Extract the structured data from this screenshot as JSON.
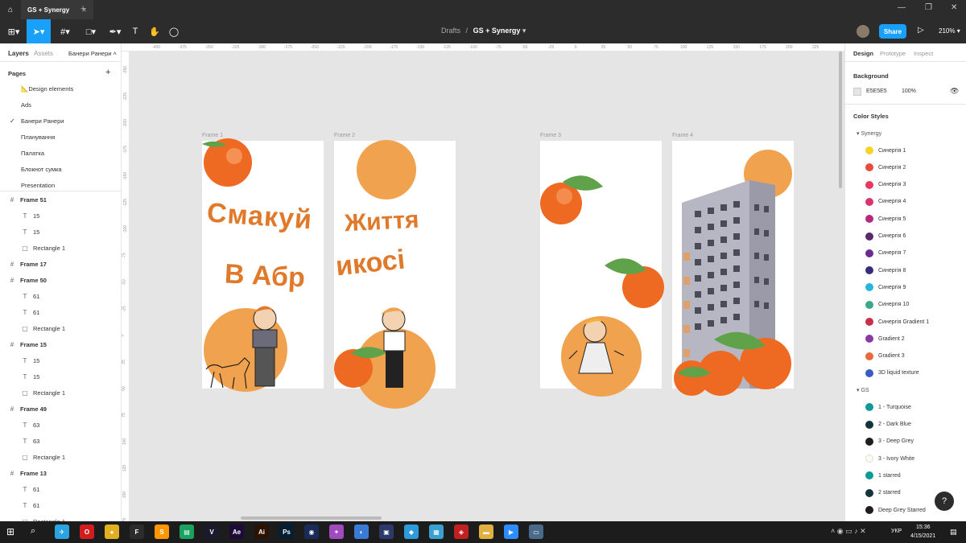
{
  "window": {
    "tab_title": "GS + Synergy",
    "new_tab": "+"
  },
  "toolbar": {
    "breadcrumb_parent": "Drafts",
    "breadcrumb_sep": "/",
    "file_name": "GS + Synergy",
    "share_label": "Share",
    "zoom": "210%",
    "accent": "#18a0fb"
  },
  "left": {
    "tabs": [
      "Layers",
      "Assets"
    ],
    "current_page": "Банери Ранери",
    "pages_label": "Pages",
    "add_icon": "+",
    "pages": [
      {
        "label": "📐Design elements",
        "checked": false
      },
      {
        "label": "Ads",
        "checked": false
      },
      {
        "label": "Банери Ранери",
        "checked": true
      },
      {
        "label": "Планування",
        "checked": false
      },
      {
        "label": "Палатка",
        "checked": false
      },
      {
        "label": "Блокнот сумка",
        "checked": false
      },
      {
        "label": "Presentation",
        "checked": false
      }
    ],
    "layers": [
      {
        "label": "Frame 51",
        "type": "frame"
      },
      {
        "label": "15",
        "type": "text"
      },
      {
        "label": "15",
        "type": "text"
      },
      {
        "label": "Rectangle 1",
        "type": "rect"
      },
      {
        "label": "Frame 17",
        "type": "frame"
      },
      {
        "label": "Frame 50",
        "type": "frame"
      },
      {
        "label": "61",
        "type": "text"
      },
      {
        "label": "61",
        "type": "text"
      },
      {
        "label": "Rectangle 1",
        "type": "rect"
      },
      {
        "label": "Frame 15",
        "type": "frame"
      },
      {
        "label": "15",
        "type": "text"
      },
      {
        "label": "15",
        "type": "text"
      },
      {
        "label": "Rectangle 1",
        "type": "rect"
      },
      {
        "label": "Frame 49",
        "type": "frame"
      },
      {
        "label": "63",
        "type": "text"
      },
      {
        "label": "63",
        "type": "text"
      },
      {
        "label": "Rectangle 1",
        "type": "rect"
      },
      {
        "label": "Frame 13",
        "type": "frame"
      },
      {
        "label": "61",
        "type": "text"
      },
      {
        "label": "61",
        "type": "text"
      },
      {
        "label": "Rectangle 1",
        "type": "rect"
      }
    ]
  },
  "right": {
    "tabs": [
      "Design",
      "Prototype",
      "Inspect"
    ],
    "background_label": "Background",
    "bg_hex": "E5E5E5",
    "bg_opacity": "100%",
    "color_styles_label": "Color Styles",
    "groups": [
      {
        "name": "Synergy",
        "items": [
          {
            "label": "Синергія 1",
            "color": "#f5d328"
          },
          {
            "label": "Синергія 2",
            "color": "#e84c3d"
          },
          {
            "label": "Синергія 3",
            "color": "#e63a5c"
          },
          {
            "label": "Синергія 4",
            "color": "#d83570"
          },
          {
            "label": "Синергія 5",
            "color": "#b52a7c"
          },
          {
            "label": "Синергія 6",
            "color": "#5b2a6e"
          },
          {
            "label": "Синергія 7",
            "color": "#6a2c8e"
          },
          {
            "label": "Синергія 8",
            "color": "#3b2b7e"
          },
          {
            "label": "Синергія 9",
            "color": "#26b5e0"
          },
          {
            "label": "Синергія 10",
            "color": "#3aa88a"
          },
          {
            "label": "Синергія Gradient 1",
            "color": "#c8304a"
          },
          {
            "label": "Gradient 2",
            "color": "#8a3aa0"
          },
          {
            "label": "Gradient 3",
            "color": "#e86a3a"
          },
          {
            "label": "3D liquid texture",
            "color": "#3a5ac8"
          }
        ]
      },
      {
        "name": "GS",
        "items": [
          {
            "label": "1 - Turquoise",
            "color": "#0f9a9a"
          },
          {
            "label": "2 - Dark Blue",
            "color": "#12343b"
          },
          {
            "label": "3 - Deep Grey",
            "color": "#1e1e1e"
          },
          {
            "label": "3 - Ivory White",
            "color": "#fbfbee"
          },
          {
            "label": "1 starred",
            "color": "#0f9a9a"
          },
          {
            "label": "2 starred",
            "color": "#12343b"
          },
          {
            "label": "Deep Grey Starred",
            "color": "#1e1e1e"
          }
        ]
      }
    ],
    "help": "?"
  },
  "canvas": {
    "ruler_top": [
      "-400",
      "-375",
      "-350",
      "-325",
      "-300",
      "-275",
      "-250",
      "-225",
      "-200",
      "-175",
      "-150",
      "-125",
      "-100",
      "-75",
      "-50",
      "-25",
      "0",
      "25",
      "50",
      "75",
      "100",
      "125",
      "150",
      "175",
      "200",
      "225"
    ],
    "ruler_left": [
      "-250",
      "-225",
      "-200",
      "-175",
      "-150",
      "-125",
      "-100",
      "-75",
      "-50",
      "-25",
      "0",
      "25",
      "50",
      "75",
      "100",
      "125",
      "150",
      "175",
      "200"
    ],
    "frames": [
      {
        "label": "Frame 1",
        "text1": "Смакуй",
        "text2": "В Абр"
      },
      {
        "label": "Frame 2",
        "text1": "Життя",
        "text2": "икосі"
      },
      {
        "label": "Frame 3"
      },
      {
        "label": "Frame 4"
      }
    ],
    "text_color": "#e07a2a",
    "orange": "#f0a24f"
  },
  "taskbar": {
    "lang": "УКР",
    "time": "15:36",
    "date": "4/15/2021",
    "apps": [
      {
        "icon": "telegram-icon",
        "color": "#2aa3e0",
        "glyph": "✈"
      },
      {
        "icon": "opera-icon",
        "color": "#d11d1d",
        "glyph": "O"
      },
      {
        "icon": "chrome-icon",
        "color": "#e0b020",
        "glyph": "●"
      },
      {
        "icon": "figma-icon",
        "color": "#2c2c2c",
        "glyph": "F"
      },
      {
        "icon": "sublime-icon",
        "color": "#ff9800",
        "glyph": "S"
      },
      {
        "icon": "sheets-icon",
        "color": "#1aa260",
        "glyph": "▤"
      },
      {
        "icon": "vectorworks-icon",
        "color": "#1a1a2e",
        "glyph": "V"
      },
      {
        "icon": "after-effects-icon",
        "color": "#1d0b3a",
        "glyph": "Ae"
      },
      {
        "icon": "illustrator-icon",
        "color": "#2d1200",
        "glyph": "Ai"
      },
      {
        "icon": "photoshop-icon",
        "color": "#041e33",
        "glyph": "Ps"
      },
      {
        "icon": "cinema4d-icon",
        "color": "#1a2b5a",
        "glyph": "◉"
      },
      {
        "icon": "vs-icon",
        "color": "#a04ac0",
        "glyph": "✦"
      },
      {
        "icon": "app-icon",
        "color": "#3a7bd5",
        "glyph": "◐"
      },
      {
        "icon": "image-icon",
        "color": "#2b3a6b",
        "glyph": "▣"
      },
      {
        "icon": "app2-icon",
        "color": "#2c9adb",
        "glyph": "◆"
      },
      {
        "icon": "app3-icon",
        "color": "#3aa0d0",
        "glyph": "▦"
      },
      {
        "icon": "app4-icon",
        "color": "#c02020",
        "glyph": "◈"
      },
      {
        "icon": "folder-icon",
        "color": "#e0b040",
        "glyph": "▬"
      },
      {
        "icon": "zoom-icon",
        "color": "#2d8cff",
        "glyph": "▶"
      },
      {
        "icon": "monitor-icon",
        "color": "#4a6a8a",
        "glyph": "▭"
      }
    ]
  }
}
